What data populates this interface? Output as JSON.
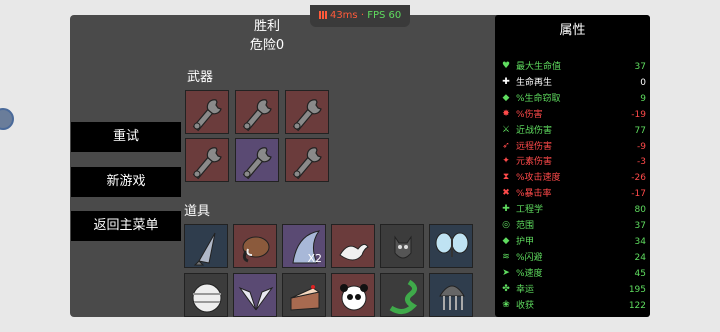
{
  "header": {
    "title": "胜利",
    "danger": "危险0"
  },
  "perf": {
    "ms": "43ms",
    "sep": " · ",
    "fps": "FPS 60"
  },
  "sections": {
    "weapons": "武器",
    "items": "道具"
  },
  "menu": {
    "retry": "重试",
    "new_game": "新游戏",
    "main_menu": "返回主菜单"
  },
  "weapons": [
    {
      "icon": "wrench-icon",
      "rarity": "red"
    },
    {
      "icon": "wrench-icon",
      "rarity": "red"
    },
    {
      "icon": "wrench-icon",
      "rarity": "red"
    },
    {
      "icon": "wrench-icon",
      "rarity": "red"
    },
    {
      "icon": "wrench-icon",
      "rarity": "purple"
    },
    {
      "icon": "wrench-icon",
      "rarity": "red"
    }
  ],
  "items": [
    {
      "icon": "rocket-icon",
      "rarity": "blue",
      "qty": ""
    },
    {
      "icon": "mammoth-icon",
      "rarity": "red",
      "qty": ""
    },
    {
      "icon": "shark-fin-icon",
      "rarity": "purple",
      "qty": "X2"
    },
    {
      "icon": "arm-icon",
      "rarity": "red",
      "qty": ""
    },
    {
      "icon": "cat-icon",
      "rarity": "gray",
      "qty": ""
    },
    {
      "icon": "butterfly-icon",
      "rarity": "blue",
      "qty": ""
    },
    {
      "icon": "mummy-head-icon",
      "rarity": "gray",
      "qty": ""
    },
    {
      "icon": "wings-icon",
      "rarity": "purple",
      "qty": ""
    },
    {
      "icon": "cake-icon",
      "rarity": "gray",
      "qty": ""
    },
    {
      "icon": "panda-icon",
      "rarity": "red",
      "qty": ""
    },
    {
      "icon": "snake-icon",
      "rarity": "gray",
      "qty": ""
    },
    {
      "icon": "jellyfish-icon",
      "rarity": "blue",
      "qty": ""
    }
  ],
  "stats": {
    "title": "属性",
    "rows": [
      {
        "icon": "heart-icon",
        "name": "最大生命值",
        "value": "37",
        "color": "#5fdc5f"
      },
      {
        "icon": "regen-icon",
        "name": "生命再生",
        "value": "0",
        "color": "#ffffff"
      },
      {
        "icon": "lifesteal-icon",
        "name": "%生命窃取",
        "value": "9",
        "color": "#5fdc5f"
      },
      {
        "icon": "damage-icon",
        "name": "%伤害",
        "value": "-19",
        "color": "#ff4a4a"
      },
      {
        "icon": "melee-icon",
        "name": "近战伤害",
        "value": "77",
        "color": "#5fdc5f"
      },
      {
        "icon": "ranged-icon",
        "name": "远程伤害",
        "value": "-9",
        "color": "#ff4a4a"
      },
      {
        "icon": "elemental-icon",
        "name": "元素伤害",
        "value": "-3",
        "color": "#ff4a4a"
      },
      {
        "icon": "attack-speed-icon",
        "name": "%攻击速度",
        "value": "-26",
        "color": "#ff4a4a"
      },
      {
        "icon": "crit-icon",
        "name": "%暴击率",
        "value": "-17",
        "color": "#ff4a4a"
      },
      {
        "icon": "engineering-icon",
        "name": "工程学",
        "value": "80",
        "color": "#5fdc5f"
      },
      {
        "icon": "range-icon",
        "name": "范围",
        "value": "37",
        "color": "#5fdc5f"
      },
      {
        "icon": "armor-icon",
        "name": "护甲",
        "value": "34",
        "color": "#5fdc5f"
      },
      {
        "icon": "dodge-icon",
        "name": "%闪避",
        "value": "24",
        "color": "#5fdc5f"
      },
      {
        "icon": "speed-icon",
        "name": "%速度",
        "value": "45",
        "color": "#5fdc5f"
      },
      {
        "icon": "luck-icon",
        "name": "幸运",
        "value": "195",
        "color": "#5fdc5f"
      },
      {
        "icon": "harvest-icon",
        "name": "收获",
        "value": "122",
        "color": "#5fdc5f"
      }
    ]
  }
}
